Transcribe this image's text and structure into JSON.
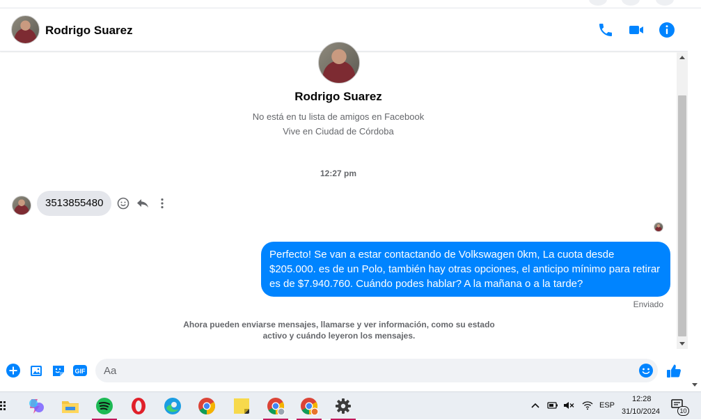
{
  "header": {
    "contact_name": "Rodrigo Suarez"
  },
  "profile": {
    "name": "Rodrigo Suarez",
    "friend_status": "No está en tu lista de amigos en Facebook",
    "location": "Vive en Ciudad de Córdoba"
  },
  "conversation": {
    "timestamp": "12:27 pm",
    "incoming_message": "3513855480",
    "outgoing_message": "Perfecto!  Se van a estar contactando de Volkswagen 0km, La cuota desde $205.000. es de un Polo, también hay otras opciones, el anticipo mínimo para retirar es de $7.940.760. Cuándo podes hablar? A la mañana o a la tarde?",
    "sent_status": "Enviado",
    "notice": "Ahora pueden enviarse mensajes, llamarse y ver información, como su estado activo y cuándo leyeron los mensajes."
  },
  "composer": {
    "placeholder": "Aa"
  },
  "taskbar": {
    "language": "ESP",
    "time": "12:28",
    "date": "31/10/2024",
    "notification_count": "10"
  },
  "colors": {
    "accent": "#0084ff",
    "incoming_bubble": "#e4e6eb",
    "taskbar": "#eaeef3"
  }
}
